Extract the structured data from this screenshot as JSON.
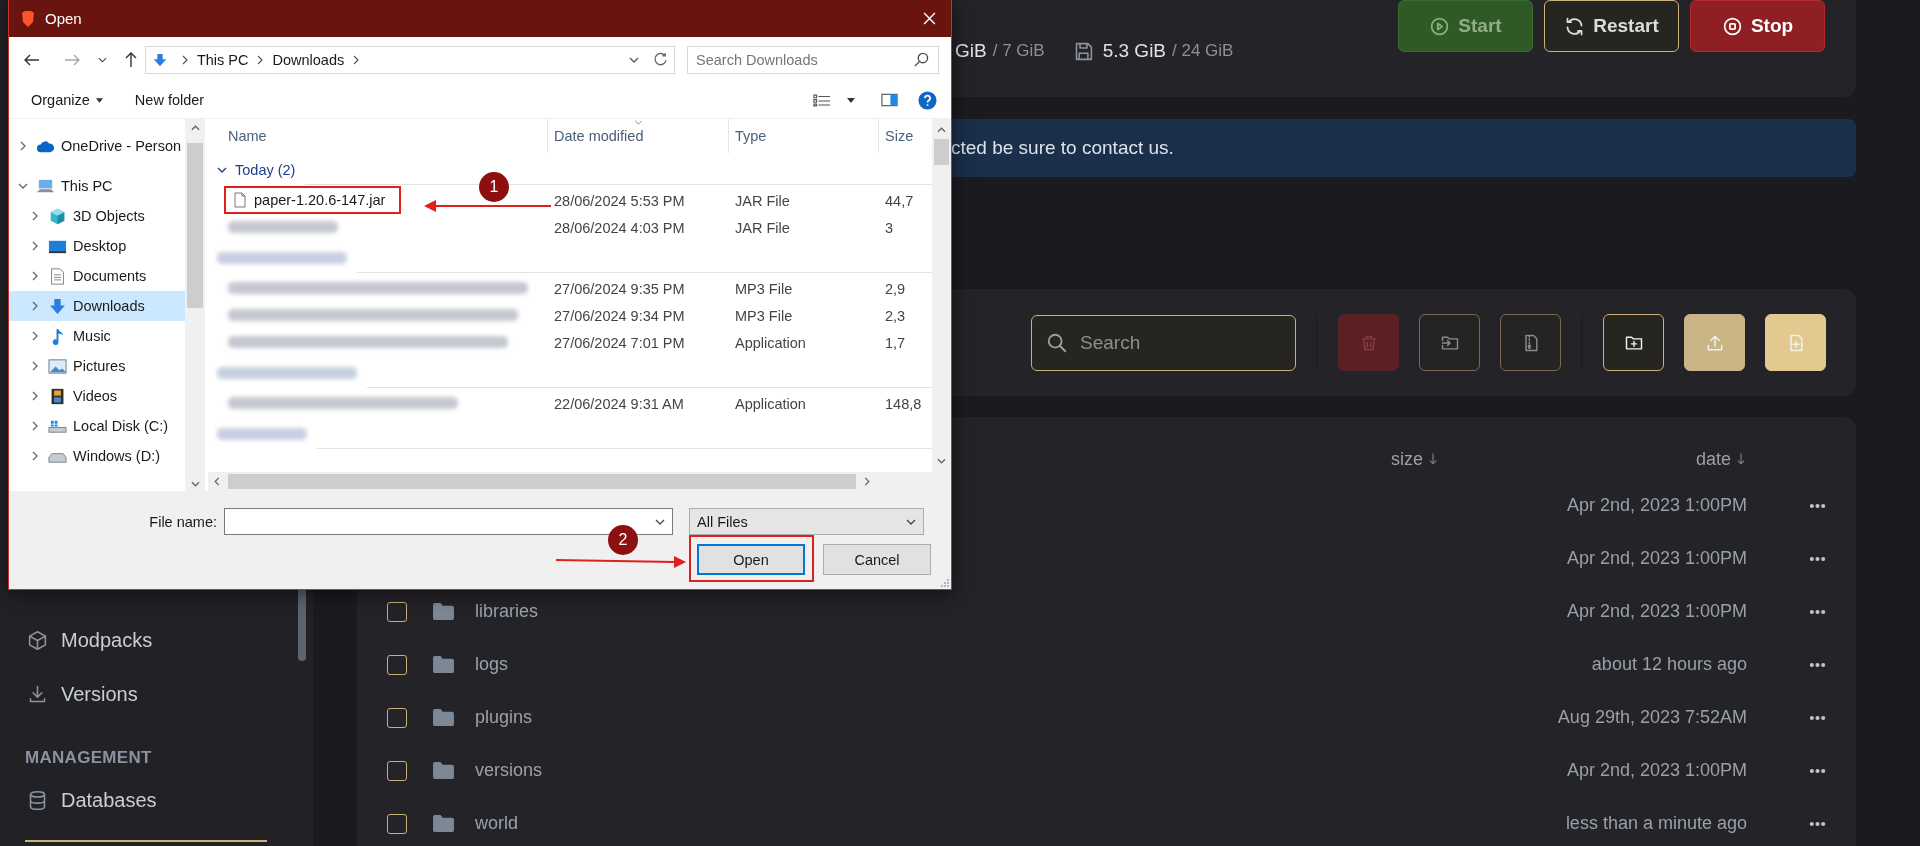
{
  "app": {
    "sidebar": {
      "items": [
        {
          "label": "Modpacks",
          "kind": "cube"
        },
        {
          "label": "Versions",
          "kind": "download"
        }
      ],
      "sections": [
        {
          "title": "MANAGEMENT",
          "items": [
            {
              "label": "Databases",
              "kind": "database"
            }
          ]
        }
      ]
    },
    "stats": [
      {
        "kind": "ram",
        "value": "GiB",
        "total": "/ 7 GiB"
      },
      {
        "kind": "disk",
        "value": "5.3 GiB",
        "total": "/ 24 GiB"
      }
    ],
    "power_buttons": [
      {
        "label": "Start",
        "kind": "start",
        "disabled": true
      },
      {
        "label": "Restart",
        "kind": "restart",
        "disabled": false
      },
      {
        "label": "Stop",
        "kind": "stop",
        "disabled": false
      }
    ],
    "banner": "cted be sure to contact us.",
    "search": {
      "placeholder": "Search"
    },
    "tools": [
      {
        "kind": "delete",
        "disabled": true
      },
      {
        "kind": "move",
        "disabled": true
      },
      {
        "kind": "archive",
        "disabled": true
      },
      {
        "kind": "new-folder",
        "disabled": false
      },
      {
        "kind": "upload",
        "disabled": false
      },
      {
        "kind": "new-file",
        "disabled": false
      }
    ],
    "columns": [
      "size",
      "date"
    ],
    "rows": [
      {
        "date": "Apr 2nd, 2023 1:00PM"
      },
      {
        "date": "Apr 2nd, 2023 1:00PM"
      },
      {
        "name": "libraries",
        "checked": false,
        "date": "Apr 2nd, 2023 1:00PM"
      },
      {
        "name": "logs",
        "checked": false,
        "date": "about 12 hours ago"
      },
      {
        "name": "plugins",
        "checked": false,
        "date": "Aug 29th, 2023 7:52AM"
      },
      {
        "name": "versions",
        "checked": false,
        "date": "Apr 2nd, 2023 1:00PM"
      },
      {
        "name": "world",
        "checked": false,
        "date": "less than a minute ago"
      }
    ]
  },
  "dialog": {
    "title": "Open",
    "path": [
      "This PC",
      "Downloads"
    ],
    "search": {
      "placeholder": "Search Downloads"
    },
    "commands": [
      "Organize",
      "New folder"
    ],
    "nav": [
      {
        "label": "OneDrive - Person",
        "kind": "cloud",
        "expanded": false,
        "selected": false
      },
      {
        "label": "This PC",
        "kind": "pc",
        "expanded": true,
        "selected": false,
        "children": [
          {
            "label": "3D Objects",
            "kind": "cube",
            "expanded": false,
            "selected": false
          },
          {
            "label": "Desktop",
            "kind": "desktop",
            "expanded": false,
            "selected": false
          },
          {
            "label": "Documents",
            "kind": "docs",
            "expanded": false,
            "selected": false
          },
          {
            "label": "Downloads",
            "kind": "download",
            "expanded": false,
            "selected": true
          },
          {
            "label": "Music",
            "kind": "music",
            "expanded": false,
            "selected": false
          },
          {
            "label": "Pictures",
            "kind": "pictures",
            "expanded": false,
            "selected": false
          },
          {
            "label": "Videos",
            "kind": "videos",
            "expanded": false,
            "selected": false
          },
          {
            "label": "Local Disk (C:)",
            "kind": "system-drive",
            "expanded": false,
            "selected": false
          },
          {
            "label": "Windows (D:)",
            "kind": "drive",
            "expanded": false,
            "selected": false
          }
        ]
      }
    ],
    "columns": [
      "Name",
      "Date modified",
      "Type",
      "Size"
    ],
    "groups": [
      {
        "label": "Today (2)",
        "blurred": false,
        "files": [
          {
            "name": "paper-1.20.6-147.jar",
            "blurred": false,
            "highlighted": true,
            "date": "28/06/2024 5:53 PM",
            "type": "JAR File",
            "size": "44,7"
          },
          {
            "blurred": true,
            "highlighted": false,
            "date": "28/06/2024 4:03 PM",
            "type": "JAR File",
            "size": "3"
          }
        ]
      },
      {
        "blurred": true,
        "files": [
          {
            "blurred": true,
            "highlighted": false,
            "date": "27/06/2024 9:35 PM",
            "type": "MP3 File",
            "size": "2,9"
          },
          {
            "blurred": true,
            "highlighted": false,
            "date": "27/06/2024 9:34 PM",
            "type": "MP3 File",
            "size": "2,3"
          },
          {
            "blurred": true,
            "highlighted": false,
            "date": "27/06/2024 7:01 PM",
            "type": "Application",
            "size": "1,7"
          }
        ]
      },
      {
        "blurred": true,
        "files": [
          {
            "blurred": true,
            "highlighted": false,
            "date": "22/06/2024 9:31 AM",
            "type": "Application",
            "size": "148,8"
          }
        ]
      },
      {
        "blurred": true
      }
    ],
    "file_name_label": "File name:",
    "file_type": "All Files",
    "buttons": [
      {
        "label": "Open",
        "default": true,
        "highlighted": true
      },
      {
        "label": "Cancel",
        "default": false,
        "highlighted": false
      }
    ]
  },
  "annotations": [
    {
      "number": "1"
    },
    {
      "number": "2"
    }
  ]
}
